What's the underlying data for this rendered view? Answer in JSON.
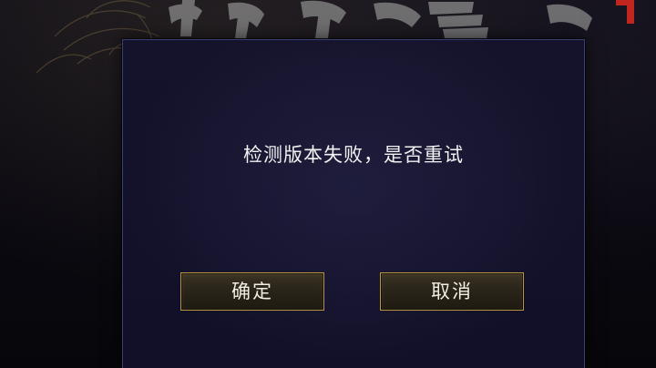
{
  "dialog": {
    "message": "检测版本失败，是否重试",
    "confirm_label": "确定",
    "cancel_label": "取消"
  },
  "colors": {
    "dialog_bg": "#13112a",
    "dialog_border": "#3a4070",
    "button_border": "#b8963f",
    "text": "#f2f2f2",
    "logo_accent": "#c0261d"
  }
}
